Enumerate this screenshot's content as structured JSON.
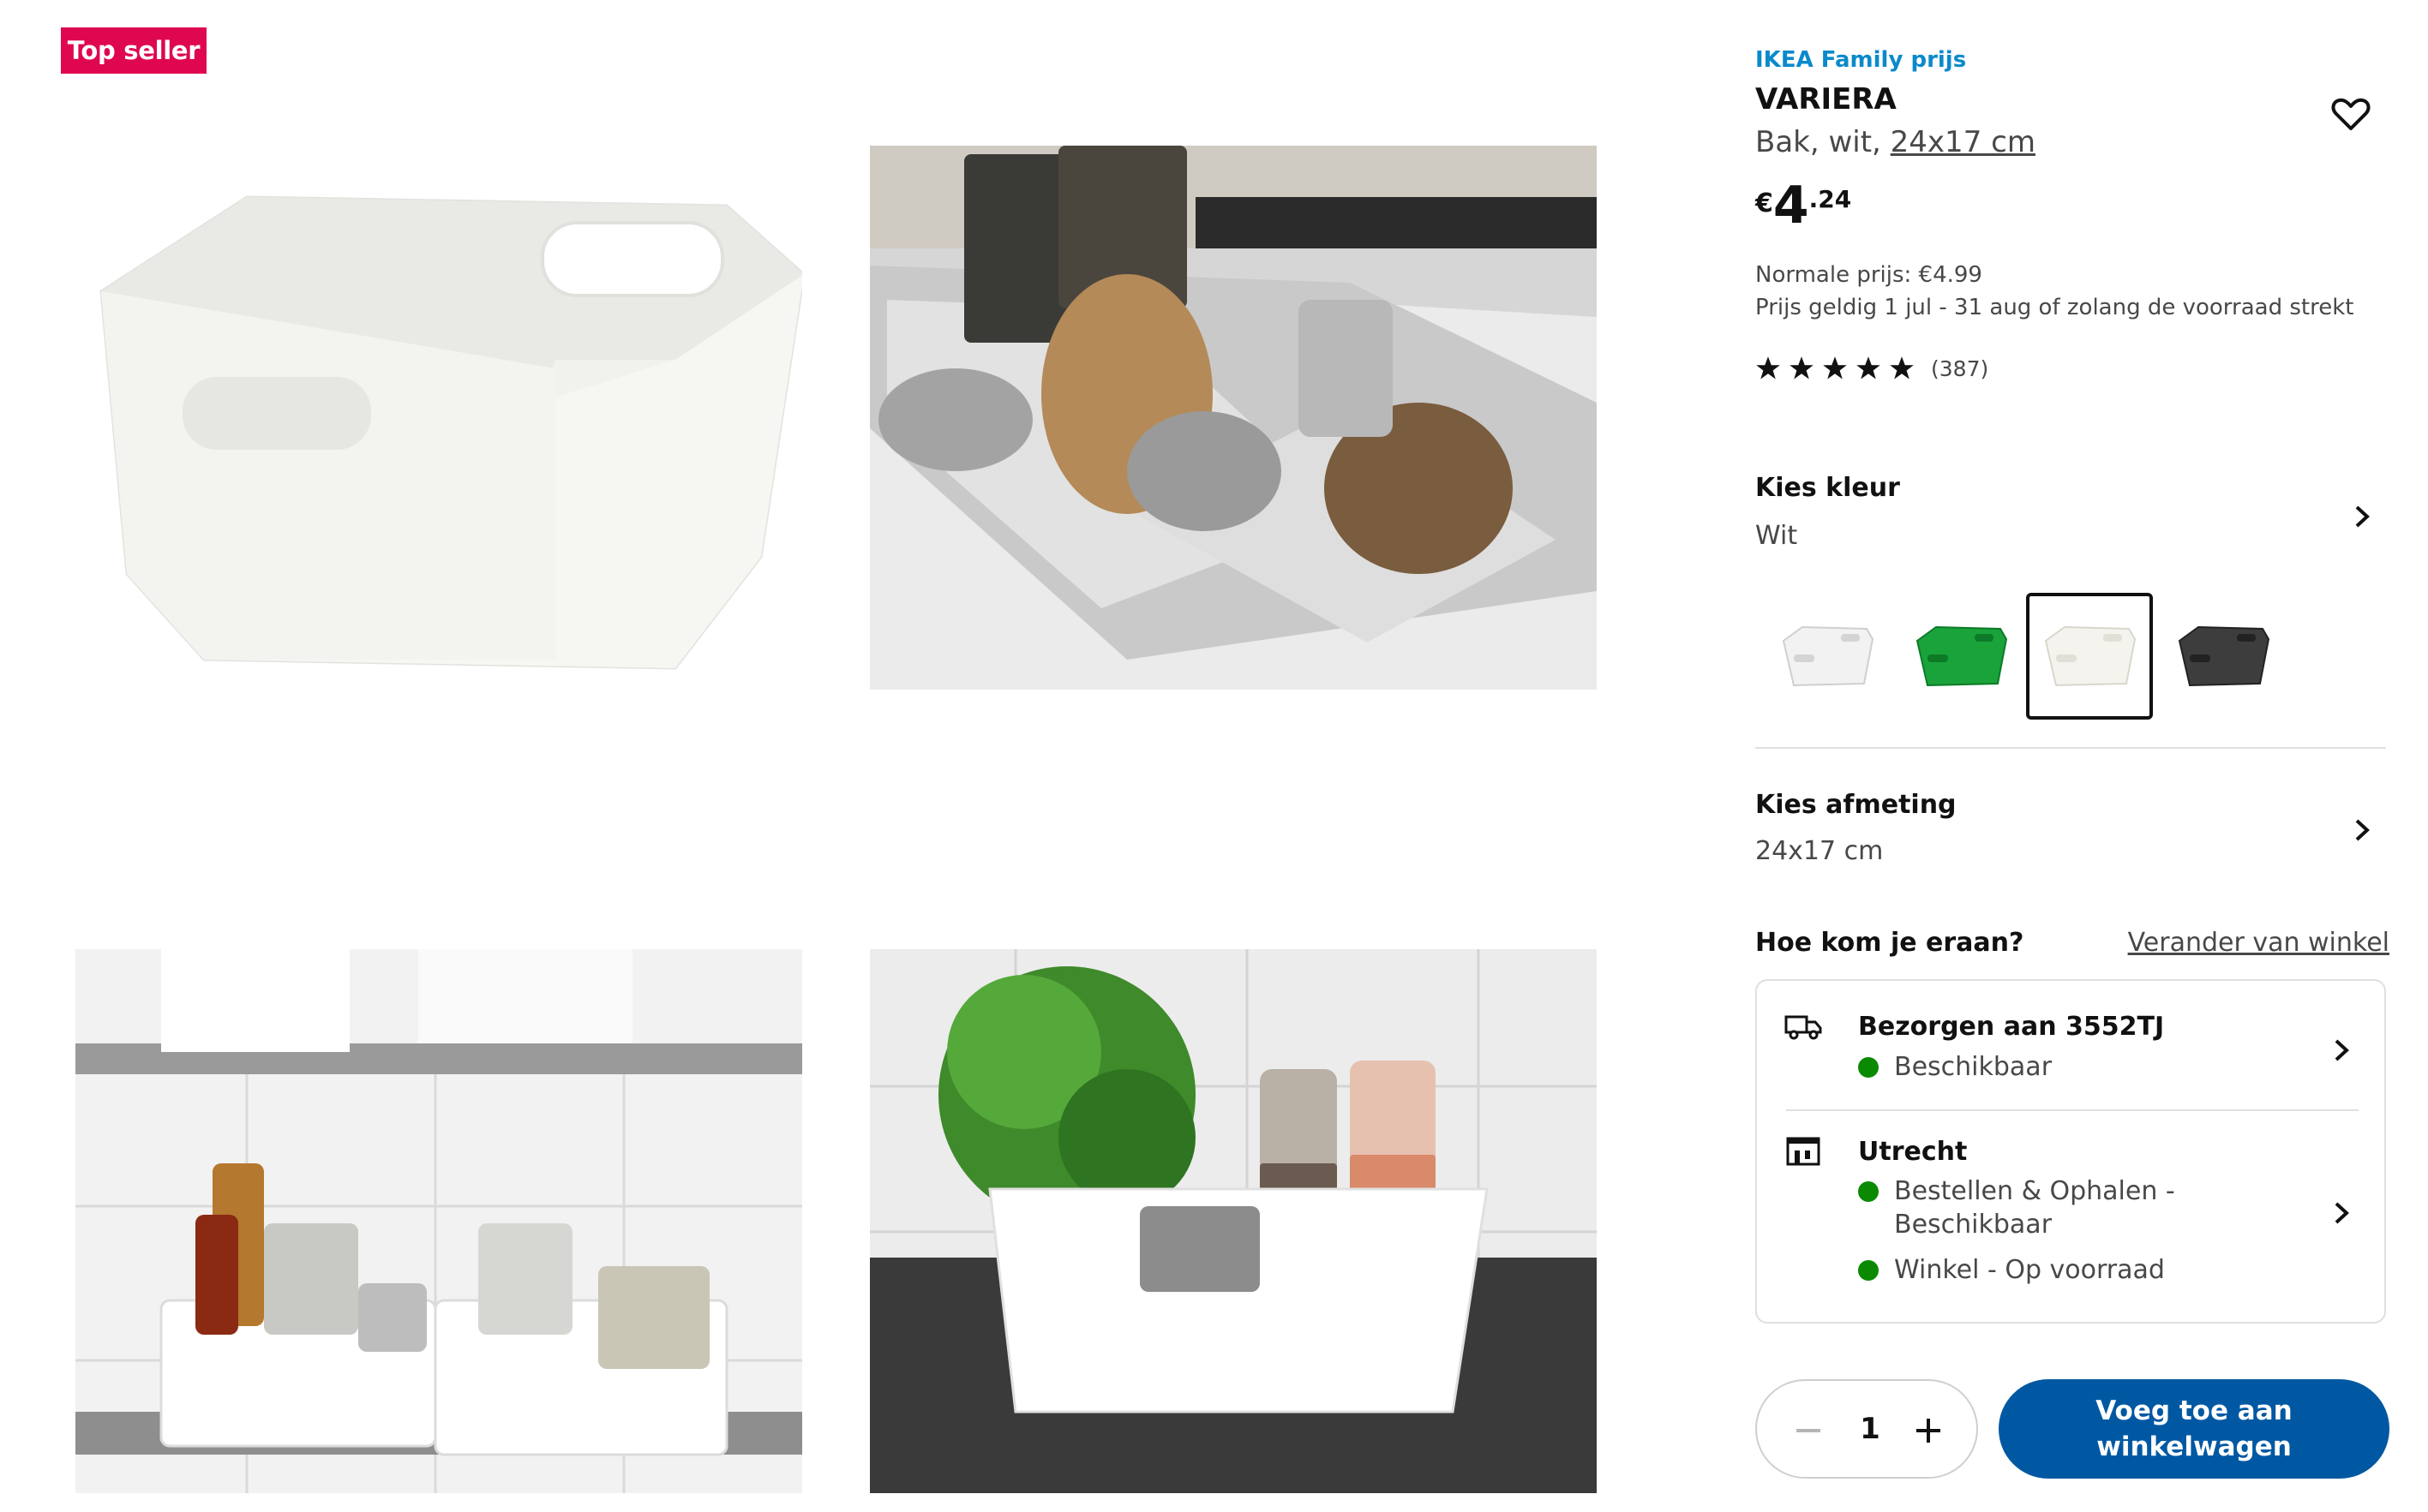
{
  "badge": {
    "label": "Top seller"
  },
  "gallery": {
    "images": [
      {
        "name": "white-bin-product-photo"
      },
      {
        "name": "drawer-with-bins-photo"
      },
      {
        "name": "shelf-with-bins-photo"
      },
      {
        "name": "bin-with-herbs-photo"
      }
    ]
  },
  "product": {
    "family_label": "IKEA Family prijs",
    "name": "VARIERA",
    "desc_prefix": "Bak, wit, ",
    "desc_size_link": "24x17 cm",
    "price": {
      "currency": "€",
      "integer": "4",
      "decimals": ".24"
    },
    "normal_price": "Normale prijs: €4.99",
    "validity": "Prijs geldig 1 jul - 31 aug of zolang de voorraad strekt",
    "rating": {
      "stars": 5,
      "count": "(387)"
    }
  },
  "color": {
    "title": "Kies kleur",
    "value": "Wit",
    "swatches": [
      {
        "name": "swatch-white",
        "color": "#f2f2f2",
        "selected": false
      },
      {
        "name": "swatch-green",
        "color": "#1aa33a",
        "selected": false
      },
      {
        "name": "swatch-off-white",
        "color": "#f5f3ee",
        "selected": true
      },
      {
        "name": "swatch-dark-grey",
        "color": "#3d3d3d",
        "selected": false
      }
    ]
  },
  "size": {
    "title": "Kies afmeting",
    "value": "24x17 cm"
  },
  "availability": {
    "title": "Hoe kom je eraan?",
    "change_store": "Verander van winkel",
    "delivery": {
      "title": "Bezorgen aan 3552TJ",
      "status": "Beschikbaar",
      "status_color": "#0a8a00"
    },
    "store": {
      "title": "Utrecht",
      "line1a": "Bestellen & Ophalen -",
      "line1b": "Beschikbaar",
      "line2": "Winkel - Op voorraad"
    }
  },
  "cart": {
    "quantity": "1",
    "add_label": "Voeg toe aan winkelwagen",
    "accent": "#0058a3"
  }
}
